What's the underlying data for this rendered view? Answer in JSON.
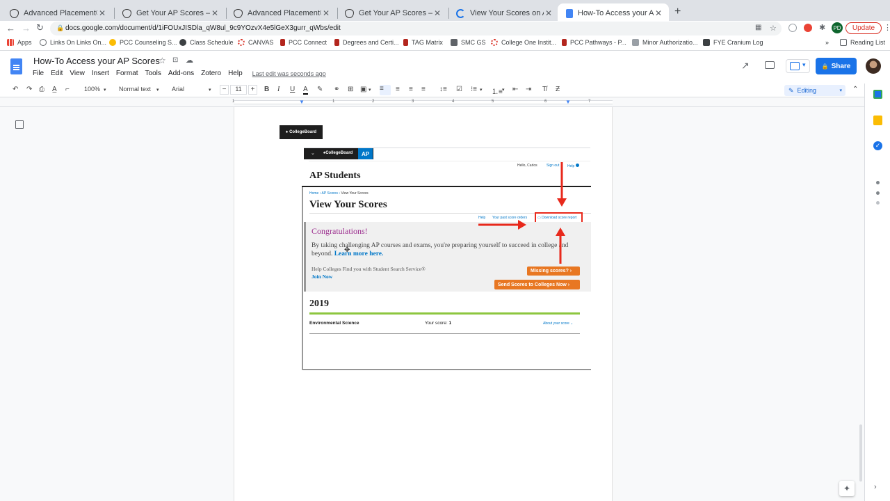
{
  "tabs": [
    {
      "label": "Advanced Placement® (AP) – T",
      "active": false
    },
    {
      "label": "Get Your AP Scores – AP Stude",
      "active": false
    },
    {
      "label": "Advanced Placement® (AP) – T",
      "active": false
    },
    {
      "label": "Get Your AP Scores – AP Stude",
      "active": false
    },
    {
      "label": "View Your Scores on AP Exam",
      "active": false
    },
    {
      "label": "How-To Access your AP Score",
      "active": true
    }
  ],
  "address": {
    "url": "docs.google.com/document/d/1iFOUxJISDla_qW8ul_9c9YOzvX4e5lGeX3gurr_qWbs/edit"
  },
  "browser": {
    "profile": "PD",
    "update_label": "Update"
  },
  "bookmarks": [
    {
      "label": "Apps",
      "icon": "apps-grid-icon"
    },
    {
      "label": "Links On Links On...",
      "icon": "link-icon"
    },
    {
      "label": "PCC Counseling S...",
      "icon": "sun-icon"
    },
    {
      "label": "Class Schedule",
      "icon": "globe-icon"
    },
    {
      "label": "CANVAS",
      "icon": "canvas-icon"
    },
    {
      "label": "PCC Connect",
      "icon": "pcc-icon"
    },
    {
      "label": "Degrees and Certi...",
      "icon": "pcc-icon"
    },
    {
      "label": "TAG Matrix",
      "icon": "tag-icon"
    },
    {
      "label": "SMC GS",
      "icon": "folder-icon"
    },
    {
      "label": "College One Instit...",
      "icon": "canvas-icon"
    },
    {
      "label": "PCC Pathways - P...",
      "icon": "pcc-icon"
    },
    {
      "label": "Minor Authorizatio...",
      "icon": "doc-icon"
    },
    {
      "label": "FYE Cranium Log",
      "icon": "doc-icon"
    }
  ],
  "reading_list": "Reading List",
  "doc": {
    "title": "How-To Access your AP Scores",
    "menu": [
      "File",
      "Edit",
      "View",
      "Insert",
      "Format",
      "Tools",
      "Add-ons",
      "Zotero",
      "Help"
    ],
    "last_edit": "Last edit was seconds ago",
    "share": "Share",
    "zoom": "100%",
    "style": "Normal text",
    "font": "Arial",
    "font_size": "11",
    "mode": "Editing"
  },
  "ruler": [
    "1",
    "1",
    "2",
    "3",
    "4",
    "5",
    "6",
    "7"
  ],
  "screenshot": {
    "collegeboard_small": "CollegeBoard",
    "collegeboard": "CollegeBoard",
    "ap_badge": "AP",
    "greeting": "Hello, Carlos",
    "sign_out": "Sign out",
    "help_top": "Help",
    "ap_students": "AP",
    "ap_students_rest": " Students",
    "breadcrumb": [
      "Home",
      "AP Scores",
      "View Your Scores"
    ],
    "page_heading": "View Your Scores",
    "links": {
      "help": "Help",
      "past_orders": "Your past score orders",
      "download": "Download score report"
    },
    "congrats": "Congratulations!",
    "body_text": "By taking challenging AP courses and exams, you're preparing yourself to succeed in college and beyond.",
    "learn_more": "Learn more here.",
    "help_colleges": "Help Colleges Find you with Student Search Service®",
    "join_now": "Join Now",
    "missing_scores": "Missing scores?  ›",
    "send_scores": "Send Scores to Colleges Now  ›",
    "year": "2019",
    "subject": "Environmental Science",
    "your_score_label": "Your score:",
    "your_score_value": "1",
    "about_score": "About your score  ⌄"
  }
}
